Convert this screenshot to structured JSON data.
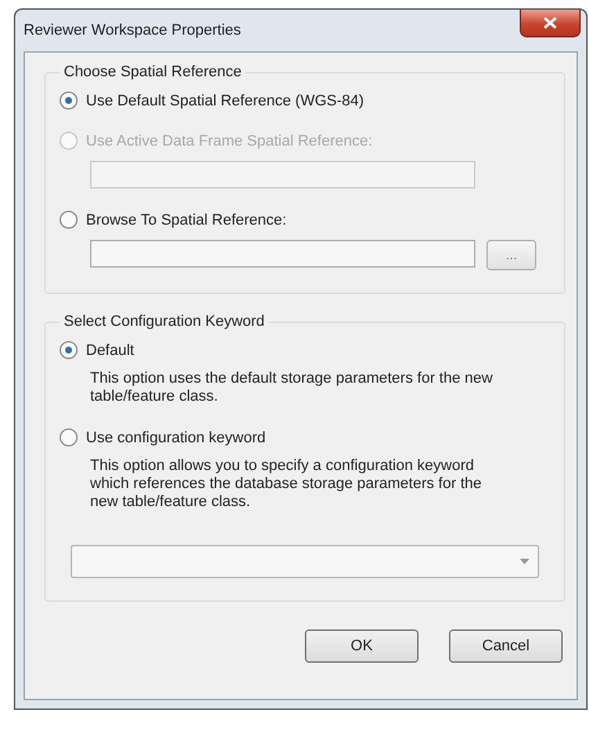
{
  "window": {
    "title": "Reviewer Workspace Properties"
  },
  "spatial_reference": {
    "title": "Choose Spatial Reference",
    "options": [
      {
        "label": "Use Default Spatial Reference (WGS-84)",
        "selected": true,
        "disabled": false,
        "kind": "plain"
      },
      {
        "label": "Use Active Data Frame Spatial Reference:",
        "selected": false,
        "disabled": true,
        "kind": "field"
      },
      {
        "label": "Browse To Spatial Reference:",
        "selected": false,
        "disabled": false,
        "kind": "browse",
        "browse_button": "..."
      }
    ]
  },
  "configuration_keyword": {
    "title": "Select Configuration Keyword",
    "options": [
      {
        "label": "Default",
        "selected": true,
        "description": "This option uses the default storage parameters for the new table/feature class.",
        "kind": "plain"
      },
      {
        "label": "Use configuration keyword",
        "selected": false,
        "description": "This option allows you to specify a configuration keyword which references the database storage parameters for the new table/feature class.",
        "kind": "dropdown"
      }
    ]
  },
  "buttons": [
    "OK",
    "Cancel"
  ]
}
